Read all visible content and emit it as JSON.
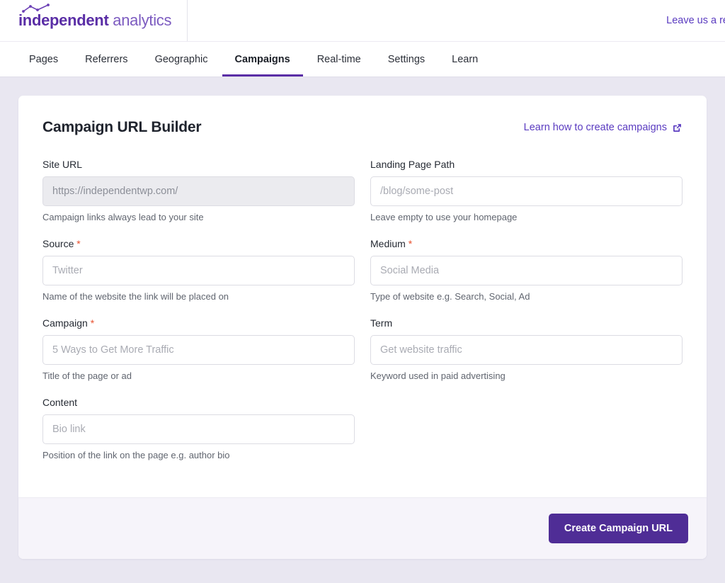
{
  "brand": {
    "name_strong": "independent",
    "name_light": "analytics",
    "logo_mark": "line-chart-icon",
    "accent_purple": "#5a2ea6",
    "link_purple": "#5a3bc0",
    "button_purple": "#4f2d96",
    "required_red": "#e8512f"
  },
  "header": {
    "leave_review_label": "Leave us a review"
  },
  "nav": {
    "items": [
      {
        "label": "Pages",
        "active": false,
        "key": "pages"
      },
      {
        "label": "Referrers",
        "active": false,
        "key": "referrers"
      },
      {
        "label": "Geographic",
        "active": false,
        "key": "geographic"
      },
      {
        "label": "Campaigns",
        "active": true,
        "key": "campaigns"
      },
      {
        "label": "Real-time",
        "active": false,
        "key": "real-time"
      },
      {
        "label": "Settings",
        "active": false,
        "key": "settings"
      },
      {
        "label": "Learn",
        "active": false,
        "key": "learn"
      }
    ]
  },
  "card": {
    "title": "Campaign URL Builder",
    "learn_link_label": "Learn how to create campaigns",
    "learn_link_icon": "external-link-icon",
    "fields": [
      {
        "key": "site_url",
        "label": "Site URL",
        "required": false,
        "value": "https://independentwp.com/",
        "placeholder": "https://independentwp.com/",
        "hint": "Campaign links always lead to your site",
        "disabled": true
      },
      {
        "key": "landing_page_path",
        "label": "Landing Page Path",
        "required": false,
        "value": "",
        "placeholder": "/blog/some-post",
        "hint": "Leave empty to use your homepage",
        "disabled": false
      },
      {
        "key": "source",
        "label": "Source",
        "required": true,
        "value": "",
        "placeholder": "Twitter",
        "hint": "Name of the website the link will be placed on",
        "disabled": false
      },
      {
        "key": "medium",
        "label": "Medium",
        "required": true,
        "value": "",
        "placeholder": "Social Media",
        "hint": "Type of website e.g. Search, Social, Ad",
        "disabled": false
      },
      {
        "key": "campaign",
        "label": "Campaign",
        "required": true,
        "value": "",
        "placeholder": "5 Ways to Get More Traffic",
        "hint": "Title of the page or ad",
        "disabled": false
      },
      {
        "key": "term",
        "label": "Term",
        "required": false,
        "value": "",
        "placeholder": "Get website traffic",
        "hint": "Keyword used in paid advertising",
        "disabled": false
      },
      {
        "key": "content",
        "label": "Content",
        "required": false,
        "value": "",
        "placeholder": "Bio link",
        "hint": "Position of the link on the page e.g. author bio",
        "disabled": false
      }
    ],
    "submit_label": "Create Campaign URL",
    "required_marker": "*"
  }
}
